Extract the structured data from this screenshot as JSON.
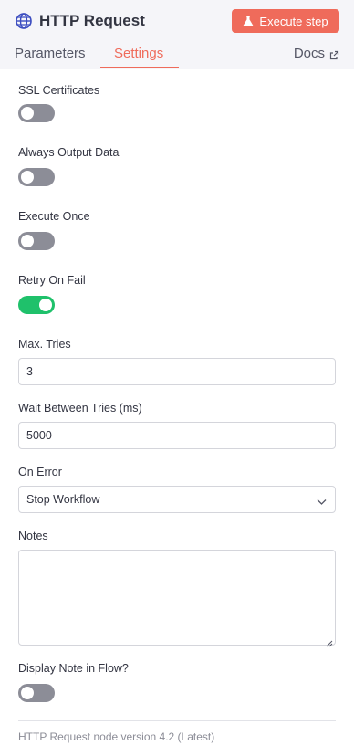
{
  "header": {
    "title": "HTTP Request",
    "node_icon": "globe-icon",
    "execute_button": {
      "label": "Execute step",
      "icon": "flask-icon"
    },
    "tabs": [
      {
        "label": "Parameters",
        "active": false
      },
      {
        "label": "Settings",
        "active": true
      }
    ],
    "docs": {
      "label": "Docs",
      "icon": "external-link-icon"
    }
  },
  "settings": {
    "ssl_certificates": {
      "label": "SSL Certificates",
      "enabled": false
    },
    "always_output_data": {
      "label": "Always Output Data",
      "enabled": false
    },
    "execute_once": {
      "label": "Execute Once",
      "enabled": false
    },
    "retry_on_fail": {
      "label": "Retry On Fail",
      "enabled": true
    },
    "max_tries": {
      "label": "Max. Tries",
      "value": "3"
    },
    "wait_between_tries": {
      "label": "Wait Between Tries (ms)",
      "value": "5000"
    },
    "on_error": {
      "label": "On Error",
      "selected": "Stop Workflow"
    },
    "notes": {
      "label": "Notes",
      "value": ""
    },
    "display_note_in_flow": {
      "label": "Display Note in Flow?",
      "enabled": false
    }
  },
  "footer": {
    "version_text": "HTTP Request node version 4.2 (Latest)"
  },
  "colors": {
    "accent": "#ef6b5b",
    "toggle_on": "#1fc16b",
    "toggle_off": "#8c8d97",
    "header_bg": "#f5f5f9"
  }
}
